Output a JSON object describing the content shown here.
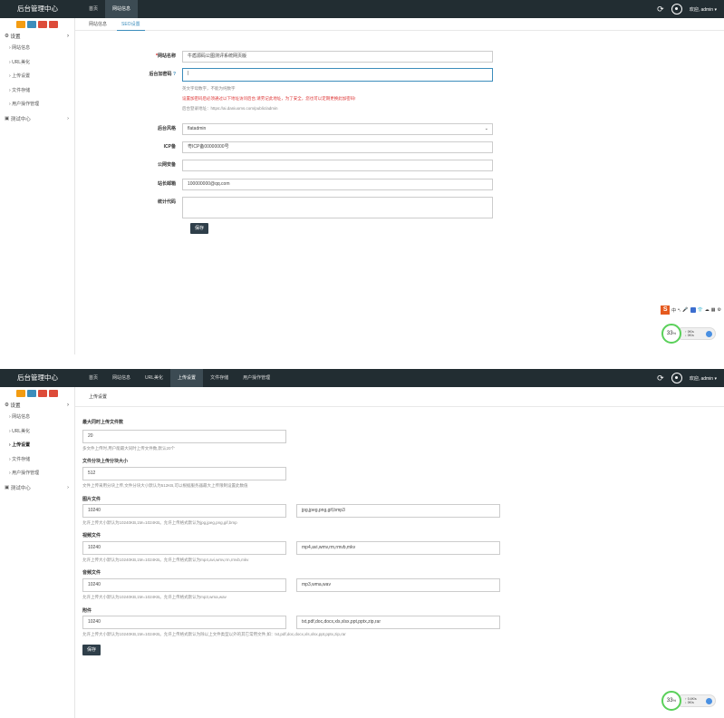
{
  "app": {
    "title": "后台管理中心",
    "welcome": "欢迎, admin"
  },
  "panel1": {
    "nav": [
      "首页",
      "网站信息"
    ],
    "sidebar": {
      "settings": "设置",
      "items": [
        "网站信息",
        "URL美化",
        "上传设置",
        "文件存储",
        "用户操作管理"
      ],
      "test": "测试中心"
    },
    "tabs": [
      "网站信息",
      "SEO设置"
    ],
    "form": {
      "site_name_label": "网站名称",
      "site_name_value": "牛盾源码公图测评系统网页版",
      "admin_key_label": "后台加密码",
      "admin_key_value": "",
      "help1": "英文字母数字，不能为纯数字",
      "warn1": "设置加密码后必须通过以下地址访问后台,请劳记此地址，为了安全，您也可以定期更换此加密码!",
      "help2": "后台登录地址：https://ai.daniuoms.com/public/admin",
      "style_label": "后台风格",
      "style_value": "flatadmin",
      "icp_label": "ICP备",
      "icp_value": "粤ICP备00000000号",
      "police_label": "公网安备",
      "police_value": "",
      "email_label": "站长邮箱",
      "email_value": "100000000@qq.com",
      "stat_label": "统计代码",
      "stat_value": "",
      "save": "保存"
    },
    "ime": {
      "brand": "S",
      "items": [
        "中",
        "•,",
        "🎤",
        "⊞",
        "👕",
        "☁",
        "▦",
        "⚙"
      ]
    },
    "monitor": {
      "percent": "33",
      "unit": "%",
      "up": "0K/s",
      "down": "0K/s"
    }
  },
  "panel2": {
    "nav": [
      "首页",
      "网站信息",
      "URL美化",
      "上传设置",
      "文件存储",
      "用户操作管理"
    ],
    "sidebar": {
      "settings": "设置",
      "items": [
        "网站信息",
        "URL美化",
        "上传设置",
        "文件存储",
        "用户操作管理"
      ],
      "test": "测试中心"
    },
    "tabs": [
      "上传设置"
    ],
    "form": {
      "max_count_label": "最大同时上传文件数",
      "max_count_value": "20",
      "max_count_help": "多文件上传时,用户能最大同时上传文件数,默认20个",
      "chunk_label": "文件分块上传分块大小",
      "chunk_value": "512",
      "chunk_help": "文件上传采用分块上传,文件分块大小默认为512KB,可以根据服务器最大上传限制设置此数值",
      "image_label": "图片文件",
      "image_size": "10240",
      "image_ext": "jpg,jpeg,png,gif,bmp3",
      "image_help": "允许上传大小默认为10240KB,1M=1024KB。允许上传格式默认为jpg,jpeg,png,gif,bmp",
      "video_label": "视频文件",
      "video_size": "10240",
      "video_ext": "mp4,avi,wmv,rm,rmvb,mkv",
      "video_help": "允许上传大小默认为10240KB,1M=1024KB。允许上传格式默认为mp4,avi,wmv,rm,rmvb,mkv",
      "audio_label": "音频文件",
      "audio_size": "10240",
      "audio_ext": "mp3,wma,wav",
      "audio_help": "允许上传大小默认为10240KB,1M=1024KB。允许上传格式默认为mp3,wma,wav",
      "attach_label": "附件",
      "attach_size": "10240",
      "attach_ext": "txt,pdf,doc,docx,xls,xlsx,ppt,pptx,zip,rar",
      "attach_help": "允许上传大小默认为10240KB,1M=1024KB。允许上传格式默认为除以上文件类型以外的其它常用文件,如：txt,pdf,doc,docx,xls,xlsx,ppt,pptx,zip,rar",
      "save": "保存"
    },
    "monitor": {
      "percent": "33",
      "unit": "%",
      "up": "0.4K/s",
      "down": "0K/s"
    }
  }
}
